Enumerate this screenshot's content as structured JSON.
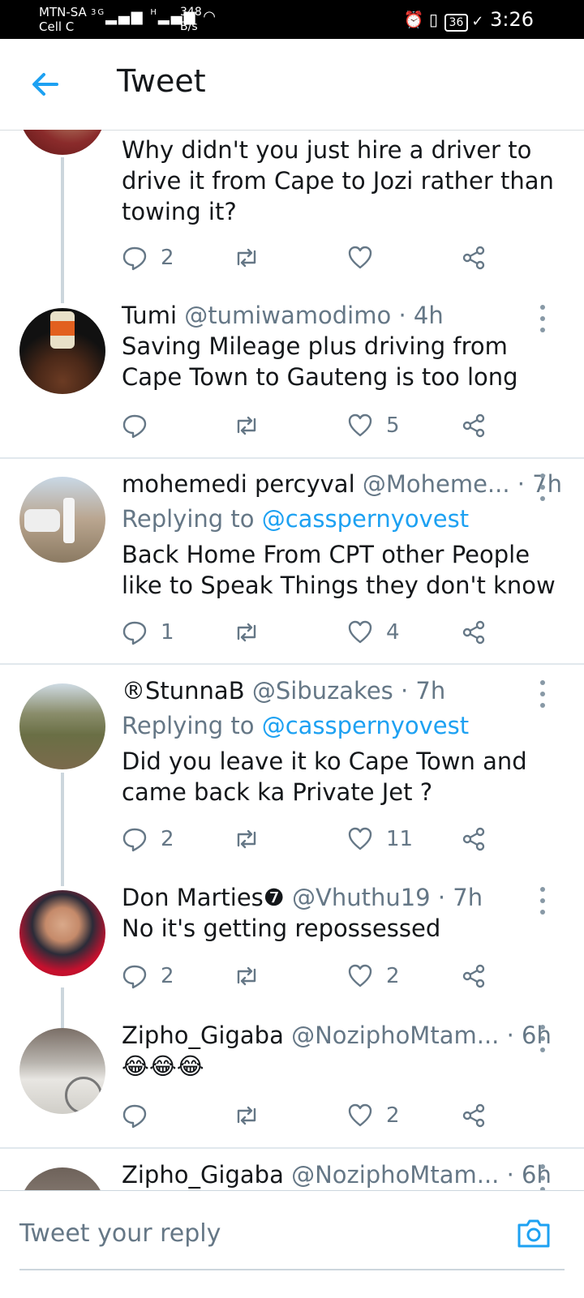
{
  "status_bar": {
    "carrier": "MTN-SA",
    "carrier2": "Cell C",
    "net1": "3G",
    "net2": "H",
    "speed_value": "348",
    "speed_unit": "B/s",
    "battery": "36",
    "time": "3:26"
  },
  "header": {
    "title": "Tweet"
  },
  "tweets": [
    {
      "text": "Why didn't you just hire a driver to drive it from Cape to Jozi rather than towing it?",
      "replies": "2",
      "retweets": "",
      "likes": ""
    },
    {
      "name": "Tumi",
      "handle": "@tumiwamodimo",
      "time": "· 4h",
      "text": "Saving Mileage plus driving from Cape Town to Gauteng is too long",
      "replies": "",
      "retweets": "",
      "likes": "5"
    },
    {
      "name": "mohemedi percyval",
      "handle": "@Moheme...",
      "time": "· 7h",
      "replying_label": "Replying to",
      "replying_to": "@cassperny­ovest",
      "text": "Back Home From CPT other People like to Speak Things they don't know",
      "replies": "1",
      "retweets": "",
      "likes": "4"
    },
    {
      "name": "®StunnaB",
      "handle": "@Sibuzakes",
      "time": "· 7h",
      "replying_label": "Replying to",
      "replying_to": "@casspernyovest",
      "text": "Did you leave it ko Cape Town and came back ka Private Jet ?",
      "replies": "2",
      "retweets": "",
      "likes": "11"
    },
    {
      "name": "Don Marties❼",
      "handle": "@Vhuthu19",
      "time": "· 7h",
      "text": "No it's getting repossessed",
      "replies": "2",
      "retweets": "",
      "likes": "2"
    },
    {
      "name": "Zipho_Gigaba",
      "handle": "@NoziphoMtam...",
      "time": "· 6h",
      "text": "😂😂😂",
      "replies": "",
      "retweets": "",
      "likes": "2"
    },
    {
      "name": "Zipho_Gigaba",
      "handle": "@NoziphoMtam...",
      "time": "· 6h"
    }
  ],
  "reply_bar": {
    "placeholder": "Tweet your reply"
  },
  "colors": {
    "accent": "#1da1f2",
    "muted": "#657786"
  }
}
